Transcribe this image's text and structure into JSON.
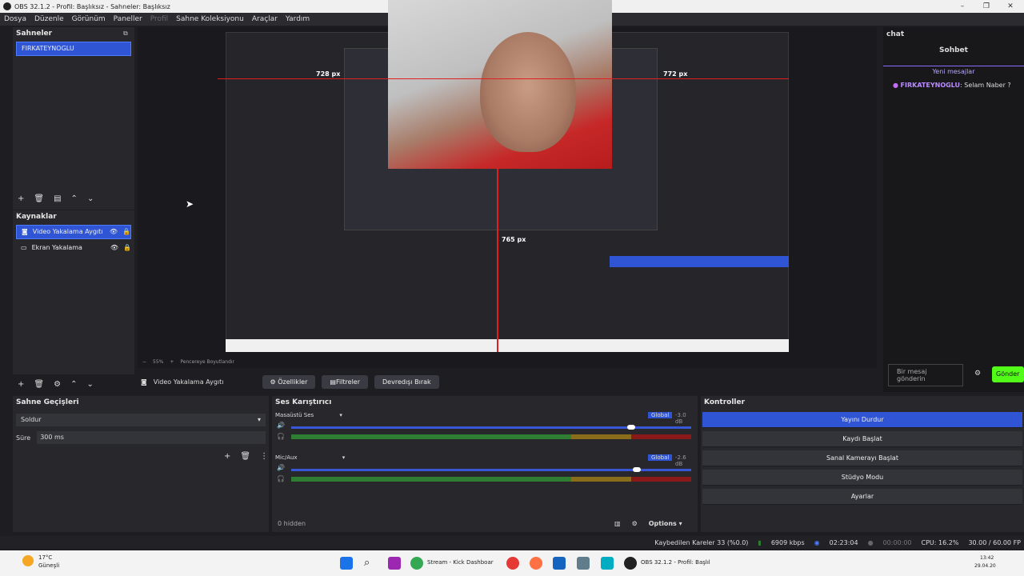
{
  "window": {
    "title": "OBS 32.1.2 - Profil: Başlıksız - Sahneler: Başlıksız"
  },
  "menu": [
    "Dosya",
    "Düzenle",
    "Görünüm",
    "Paneller",
    "Profil",
    "Sahne Koleksiyonu",
    "Araçlar",
    "Yardım"
  ],
  "scenes": {
    "title": "Sahneler",
    "items": [
      "FIRKATEYNOGLU"
    ]
  },
  "sources": {
    "title": "Kaynaklar",
    "items": [
      "Video Yakalama Aygıtı",
      "Ekran Yakalama"
    ]
  },
  "preview": {
    "labels": [
      "728 px",
      "772 px",
      "765 px"
    ],
    "zoom": "55%",
    "fit_label": "Pencereye Boyutlandır"
  },
  "source_toolbar": {
    "selected": "Video Yakalama Aygıtı",
    "properties": "Özellikler",
    "filters": "Filtreler",
    "deactivate": "Devredışı Bırak"
  },
  "transitions": {
    "title": "Sahne Geçişleri",
    "selected": "Soldur",
    "duration_label": "Süre",
    "duration": "300 ms"
  },
  "mixer": {
    "title": "Ses Karıştırıcı",
    "channels": [
      {
        "name": "Masaüstü Ses",
        "tag": "Global",
        "db": "-3.0 dB",
        "level": 0.78
      },
      {
        "name": "Mic/Aux",
        "tag": "Global",
        "db": "-2.6 dB",
        "level": 0.79
      }
    ],
    "ticks": [
      "-60",
      "-54",
      "-48",
      "-42",
      "-36",
      "-30",
      "-24",
      "-18",
      "-12",
      "-6",
      "0"
    ],
    "hidden": "0 hidden",
    "options": "Options"
  },
  "controls": {
    "title": "Kontroller",
    "buttons": [
      "Yayını Durdur",
      "Kaydı Başlat",
      "Sanal Kamerayı Başlat",
      "Stüdyo Modu",
      "Ayarlar"
    ]
  },
  "chat": {
    "title": "chat",
    "header": "Sohbet",
    "new_messages": "Yeni mesajlar",
    "messages": [
      {
        "user": "FIRKATEYNOGLU",
        "text": ": Selam Naber ?"
      }
    ],
    "input_placeholder": "Bir mesaj gönderin",
    "send": "Gönder"
  },
  "status": {
    "dropped": "Kaybedilen Kareler 33 (%0.0)",
    "bitrate": "6909 kbps",
    "live_time": "02:23:04",
    "rec_time": "00:00:00",
    "cpu": "CPU: 16.2%",
    "fps": "30.00 / 60.00 FP"
  },
  "taskbar": {
    "weather_temp": "17°C",
    "weather_text": "Güneşli",
    "apps": [
      "Stream - Kick Dashboar",
      "OBS 32.1.2 - Profil: Başlıl"
    ],
    "time": "13:42",
    "date": "29.04.20"
  }
}
